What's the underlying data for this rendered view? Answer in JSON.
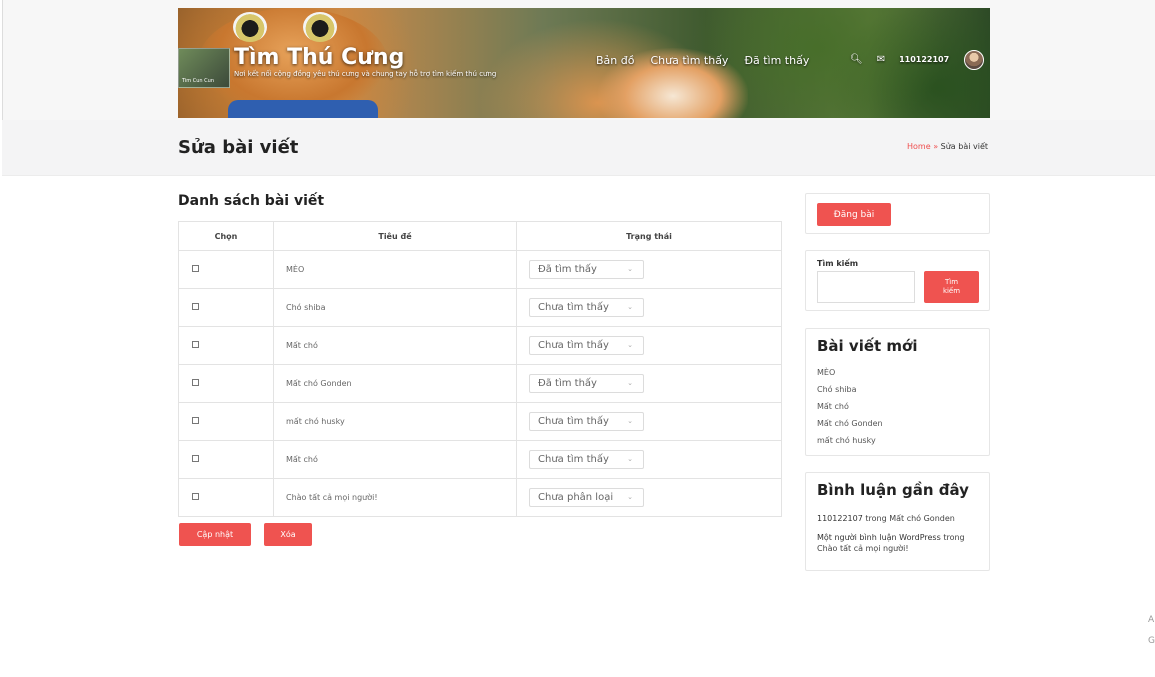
{
  "site": {
    "title": "Tìm Thú Cưng",
    "tagline": "Nơi kết nối cộng đồng yêu thú cưng và chung tay hỗ trợ tìm kiếm thú cưng",
    "logo_caption": "Tim Cun Cun",
    "nav": [
      "Bản đồ",
      "Chưa tìm thấy",
      "Đã tìm thấy"
    ],
    "username": "110122107"
  },
  "page": {
    "title": "Sửa bài viết",
    "breadcrumb_home": "Home",
    "breadcrumb_sep": "»",
    "breadcrumb_current": "Sửa bài viết"
  },
  "list": {
    "heading": "Danh sách bài viết",
    "columns": [
      "Chọn",
      "Tiêu đề",
      "Trạng thái"
    ],
    "rows": [
      {
        "title": "MÈO",
        "status": "Đã tìm thấy"
      },
      {
        "title": "Chó shiba",
        "status": "Chưa tìm thấy"
      },
      {
        "title": "Mất chó",
        "status": "Chưa tìm thấy"
      },
      {
        "title": "Mất chó Gonden",
        "status": "Đã tìm thấy"
      },
      {
        "title": "mất chó husky",
        "status": "Chưa tìm thấy"
      },
      {
        "title": "Mất chó",
        "status": "Chưa tìm thấy"
      },
      {
        "title": "Chào tất cả mọi người!",
        "status": "Chưa phân loại"
      }
    ],
    "update_label": "Cập nhật",
    "delete_label": "Xóa"
  },
  "sidebar": {
    "post_button": "Đăng bài",
    "search_label": "Tìm kiếm",
    "search_button_line1": "Tìm",
    "search_button_line2": "kiếm",
    "recent_title": "Bài viết mới",
    "recent_posts": [
      "MÈO",
      "Chó shiba",
      "Mất chó",
      "Mất chó Gonden",
      "mất chó husky"
    ],
    "comments_title": "Bình luận gần đây",
    "comments": [
      {
        "author": "110122107",
        "sep": "trong",
        "post": "Mất chó Gonden"
      },
      {
        "author": "Một người bình luận WordPress",
        "sep": "trong",
        "post": "Chào tất cả mọi người!"
      }
    ]
  },
  "edge_glyphs": [
    "A",
    "G"
  ]
}
